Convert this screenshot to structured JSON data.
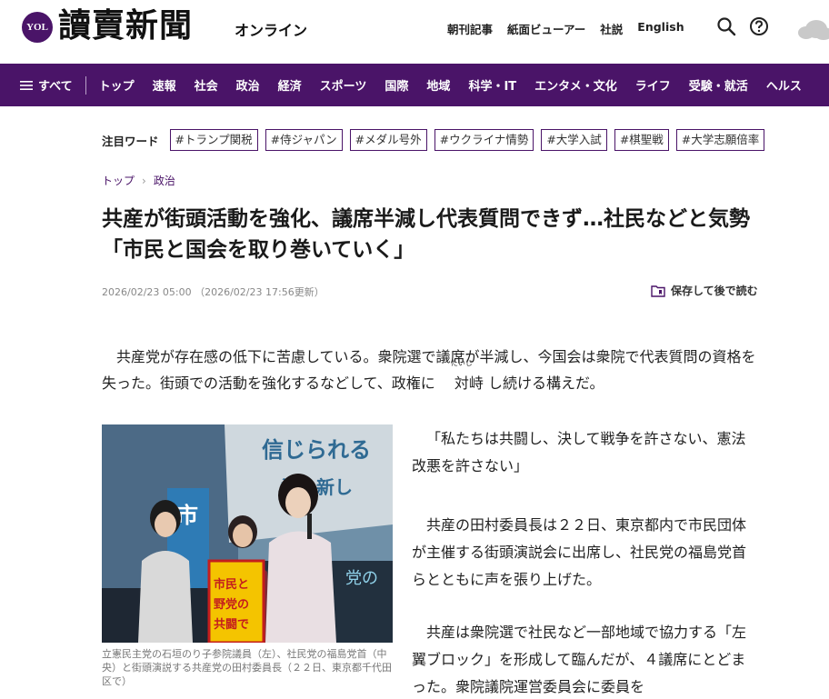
{
  "header": {
    "logo_badge": "YOL",
    "logo_text": "讀賣新聞",
    "logo_sub": "オンライン",
    "links": [
      "朝刊記事",
      "紙面ビューアー",
      "社説",
      "English"
    ],
    "icons": [
      "search-icon",
      "help-icon",
      "weather-icon"
    ]
  },
  "nav": {
    "all_label": "すべて",
    "items": [
      "トップ",
      "速報",
      "社会",
      "政治",
      "経済",
      "スポーツ",
      "国際",
      "地域",
      "科学・IT",
      "エンタメ・文化",
      "ライフ",
      "受験・就活",
      "ヘルス"
    ]
  },
  "trending": {
    "label": "注目ワード",
    "tags": [
      "#トランプ関税",
      "#侍ジャパン",
      "#メダル号外",
      "#ウクライナ情勢",
      "#大学入試",
      "#棋聖戦",
      "#大学志願倍率"
    ]
  },
  "breadcrumb": {
    "items": [
      "トップ",
      "政治"
    ]
  },
  "article": {
    "title": "共産が街頭活動を強化、議席半減し代表質問できず…社民などと気勢「市民と国会を取り巻いていく」",
    "published": "2026/02/23 05:00",
    "updated": "（2026/02/23 17:56更新）",
    "save_label": "保存して後で読む",
    "lead_pre": "共産党が存在感の低下に苦慮している。衆院選で議席が半減し、今国会は衆院で代表質問の資格を失った。街頭での活動を強化するなどして、政権に",
    "lead_ruby_base": "対峙",
    "lead_ruby_text": "たいじ",
    "lead_post": "し続ける構えだ。",
    "photo_caption": "立憲民主党の石垣のり子参院議員（左）、社民党の福島党首（中央）と街頭演説する共産党の田村委員長（２２日、東京都千代田区で）",
    "paragraphs": [
      "「私たちは共闘し、決して戦争を許さない、憲法改悪を許さない」",
      "共産の田村委員長は２２日、東京都内で市民団体が主催する街頭演説会に出席し、社民党の福島党首らとともに声を張り上げた。",
      "共産は衆院選で社民など一部地域で協力する「左翼ブロック」を形成して臨んだが、４議席にとどまった。衆院議院運営委員会に委員を"
    ]
  },
  "photo_signage": {
    "banner_top": "信じられる",
    "banner_mid": "希の新し",
    "sign_left": "市",
    "placard_top": "市民と",
    "placard_mid": "野党の",
    "placard_bot": "共闘で",
    "podium_text": "党の"
  },
  "colors": {
    "brand_purple": "#4a1468",
    "nav_text": "#ffffff"
  }
}
